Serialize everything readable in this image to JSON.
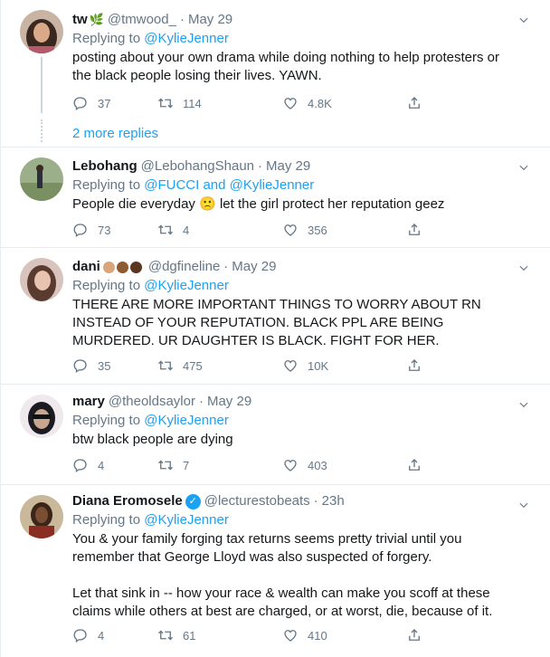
{
  "tweets": [
    {
      "name": "tw",
      "name_emoji": "🌿",
      "handle": "@tmwood_",
      "separator": "·",
      "time": "May 29",
      "replying_prefix": "Replying to ",
      "replying_to": "@KylieJenner",
      "text": "posting about your own drama while doing nothing to help protesters or the black people losing their lives. YAWN.",
      "replies": "37",
      "retweets": "114",
      "likes": "4.8K",
      "more_replies": "2 more replies"
    },
    {
      "name": "Lebohang",
      "handle": "@LebohangShaun",
      "separator": "·",
      "time": "May 29",
      "replying_prefix": "Replying to ",
      "replying_to": "@FUCCI and @KylieJenner",
      "text_before_emoji": "People die everyday ",
      "text_emoji": "🙁",
      "text_after_emoji": " let the girl protect her reputation geez",
      "replies": "73",
      "retweets": "4",
      "likes": "356"
    },
    {
      "name": "dani",
      "skin_tones": [
        "#d8a67a",
        "#8d5a33",
        "#5a3520"
      ],
      "handle": "@dgfineline",
      "separator": "·",
      "time": "May 29",
      "replying_prefix": "Replying to ",
      "replying_to": "@KylieJenner",
      "text": "THERE ARE MORE IMPORTANT THINGS TO WORRY ABOUT RN INSTEAD OF YOUR REPUTATION. BLACK PPL ARE BEING MURDERED. UR DAUGHTER IS BLACK. FIGHT FOR HER.",
      "replies": "35",
      "retweets": "475",
      "likes": "10K"
    },
    {
      "name": "mary",
      "handle": "@theoldsaylor",
      "separator": "·",
      "time": "May 29",
      "replying_prefix": "Replying to ",
      "replying_to": "@KylieJenner",
      "text": "btw black people are dying",
      "replies": "4",
      "retweets": "7",
      "likes": "403"
    },
    {
      "name": "Diana Eromosele",
      "verified_mark": "✓",
      "handle": "@lecturestobeats",
      "separator": "·",
      "time": "23h",
      "replying_prefix": "Replying to ",
      "replying_to": "@KylieJenner",
      "text": "You & your family forging tax returns seems pretty trivial until you remember that George Lloyd was also suspected of forgery.\n\nLet that sink in -- how your race & wealth can make you scoff at these claims while others at best are charged, or at worst, die, because of it.",
      "replies": "4",
      "retweets": "61",
      "likes": "410"
    }
  ],
  "colors": {
    "accent": "#1da1f2",
    "secondary_text": "#657786",
    "border": "#e6ecf0"
  }
}
